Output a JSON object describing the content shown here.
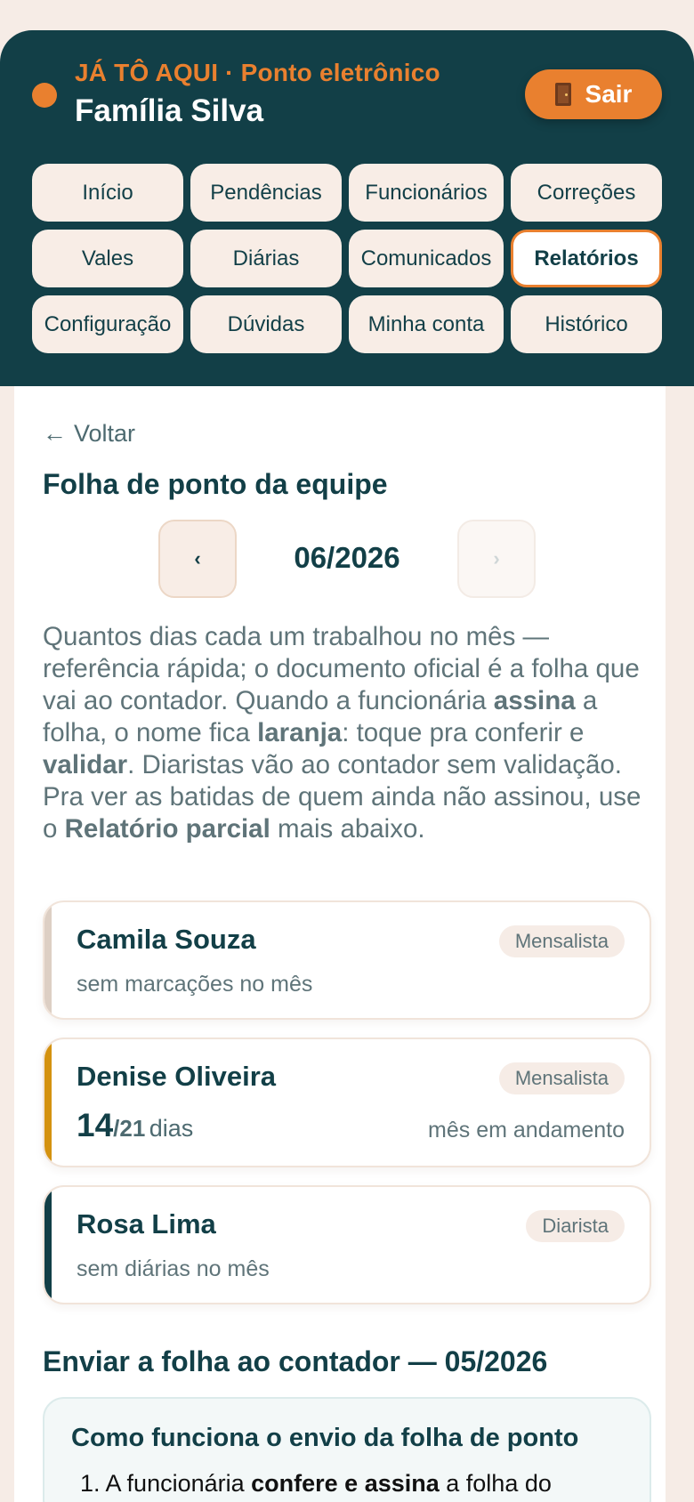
{
  "header": {
    "tag": "JÁ TÔ AQUI · Ponto eletrônico",
    "family": "Família Silva",
    "logout_label": "Sair"
  },
  "nav": {
    "items": [
      {
        "label": "Início",
        "active": false
      },
      {
        "label": "Pendências",
        "active": false
      },
      {
        "label": "Funcionários",
        "active": false
      },
      {
        "label": "Correções",
        "active": false
      },
      {
        "label": "Vales",
        "active": false
      },
      {
        "label": "Diárias",
        "active": false
      },
      {
        "label": "Comunicados",
        "active": false
      },
      {
        "label": "Relatórios",
        "active": true
      },
      {
        "label": "Configuração",
        "active": false
      },
      {
        "label": "Dúvidas",
        "active": false
      },
      {
        "label": "Minha conta",
        "active": false
      },
      {
        "label": "Histórico",
        "active": false
      }
    ]
  },
  "back_label": "Voltar",
  "section_title": "Folha de ponto da equipe",
  "month": {
    "current": "06/2026",
    "prev_icon": "‹",
    "next_icon": "›"
  },
  "intro": {
    "p1": "Quantos dias cada um trabalhou no mês — referência rápida; o documento oficial é a folha que vai ao contador. Quando a funcionária ",
    "b1": "assina",
    "p2": " a folha, o nome fica ",
    "b2": "laranja",
    "p3": ": toque pra conferir e ",
    "b3": "validar",
    "p4": ". Diaristas vão ao contador sem validação. Pra ver as batidas de quem ainda não assinou, use o ",
    "b4": "Relatório parcial",
    "p5": " mais abaixo."
  },
  "employees": [
    {
      "name": "Camila Souza",
      "type": "Mensalista",
      "note": "sem marcações no mês",
      "accent": "#ddcfc4"
    },
    {
      "name": "Denise Oliveira",
      "type": "Mensalista",
      "days": "14",
      "total": "/21",
      "unit": "dias",
      "status": "mês em andamento",
      "accent": "#d4920f"
    },
    {
      "name": "Rosa Lima",
      "type": "Diarista",
      "note": "sem diárias no mês",
      "accent": "#123f47"
    }
  ],
  "send": {
    "title": "Enviar a folha ao contador — 05/2026",
    "info_title": "Como funciona o envio da folha de ponto",
    "step1_a": "1. A funcionária ",
    "step1_b": "confere e assina",
    "step1_c": " a folha do"
  },
  "colors": {
    "brand_dark": "#123f47",
    "brand_orange": "#e9802f",
    "background": "#f6ece6"
  }
}
